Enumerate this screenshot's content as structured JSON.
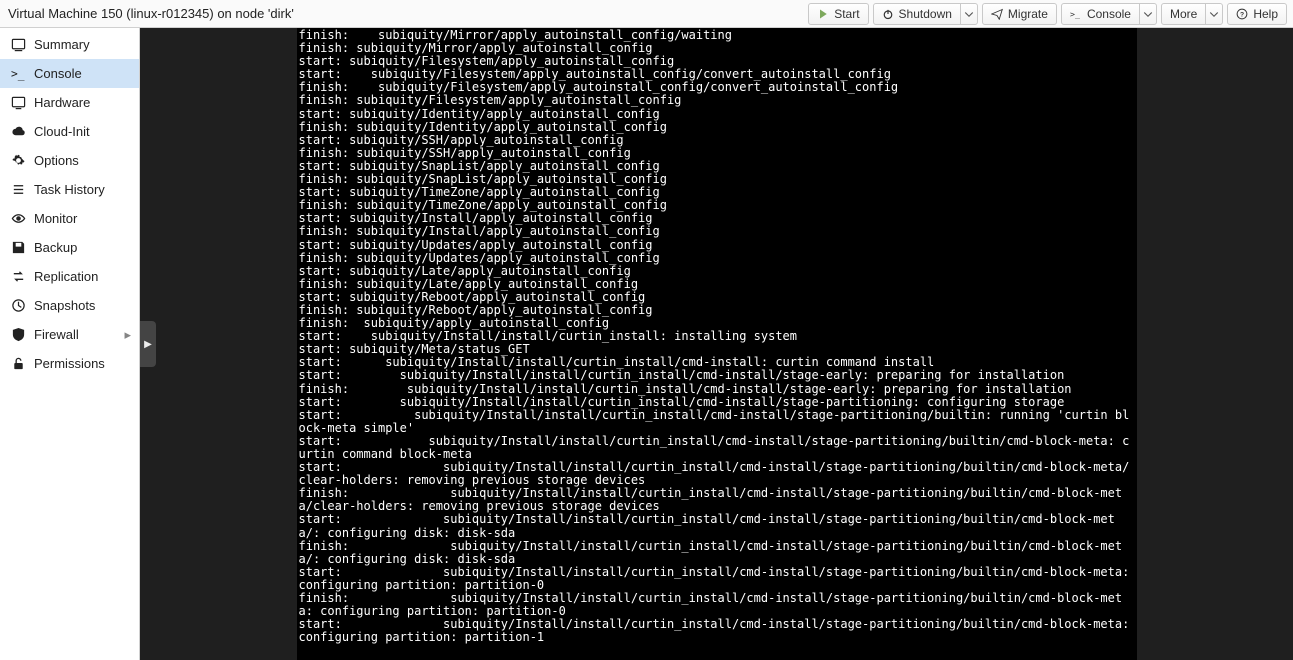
{
  "header": {
    "title": "Virtual Machine 150 (linux-r012345) on node 'dirk'"
  },
  "toolbar": {
    "start": "Start",
    "shutdown": "Shutdown",
    "migrate": "Migrate",
    "console": "Console",
    "more": "More",
    "help": "Help"
  },
  "sidebar": {
    "items": [
      {
        "id": "summary",
        "label": "Summary"
      },
      {
        "id": "console",
        "label": "Console"
      },
      {
        "id": "hardware",
        "label": "Hardware"
      },
      {
        "id": "cloud-init",
        "label": "Cloud-Init"
      },
      {
        "id": "options",
        "label": "Options"
      },
      {
        "id": "task-history",
        "label": "Task History"
      },
      {
        "id": "monitor",
        "label": "Monitor"
      },
      {
        "id": "backup",
        "label": "Backup"
      },
      {
        "id": "replication",
        "label": "Replication"
      },
      {
        "id": "snapshots",
        "label": "Snapshots"
      },
      {
        "id": "firewall",
        "label": "Firewall"
      },
      {
        "id": "permissions",
        "label": "Permissions"
      }
    ],
    "selected": "console"
  },
  "terminal": {
    "lines": "finish:    subiquity/Mirror/apply_autoinstall_config/waiting\nfinish: subiquity/Mirror/apply_autoinstall_config\nstart: subiquity/Filesystem/apply_autoinstall_config\nstart:    subiquity/Filesystem/apply_autoinstall_config/convert_autoinstall_config\nfinish:    subiquity/Filesystem/apply_autoinstall_config/convert_autoinstall_config\nfinish: subiquity/Filesystem/apply_autoinstall_config\nstart: subiquity/Identity/apply_autoinstall_config\nfinish: subiquity/Identity/apply_autoinstall_config\nstart: subiquity/SSH/apply_autoinstall_config\nfinish: subiquity/SSH/apply_autoinstall_config\nstart: subiquity/SnapList/apply_autoinstall_config\nfinish: subiquity/SnapList/apply_autoinstall_config\nstart: subiquity/TimeZone/apply_autoinstall_config\nfinish: subiquity/TimeZone/apply_autoinstall_config\nstart: subiquity/Install/apply_autoinstall_config\nfinish: subiquity/Install/apply_autoinstall_config\nstart: subiquity/Updates/apply_autoinstall_config\nfinish: subiquity/Updates/apply_autoinstall_config\nstart: subiquity/Late/apply_autoinstall_config\nfinish: subiquity/Late/apply_autoinstall_config\nstart: subiquity/Reboot/apply_autoinstall_config\nfinish: subiquity/Reboot/apply_autoinstall_config\nfinish:  subiquity/apply_autoinstall_config\nstart:    subiquity/Install/install/curtin_install: installing system\nstart: subiquity/Meta/status_GET\nstart:      subiquity/Install/install/curtin_install/cmd-install: curtin command install\nstart:        subiquity/Install/install/curtin_install/cmd-install/stage-early: preparing for installation\nfinish:        subiquity/Install/install/curtin_install/cmd-install/stage-early: preparing for installation\nstart:        subiquity/Install/install/curtin_install/cmd-install/stage-partitioning: configuring storage\nstart:          subiquity/Install/install/curtin_install/cmd-install/stage-partitioning/builtin: running 'curtin block-meta simple'\nstart:            subiquity/Install/install/curtin_install/cmd-install/stage-partitioning/builtin/cmd-block-meta: curtin command block-meta\nstart:              subiquity/Install/install/curtin_install/cmd-install/stage-partitioning/builtin/cmd-block-meta/clear-holders: removing previous storage devices\nfinish:              subiquity/Install/install/curtin_install/cmd-install/stage-partitioning/builtin/cmd-block-meta/clear-holders: removing previous storage devices\nstart:              subiquity/Install/install/curtin_install/cmd-install/stage-partitioning/builtin/cmd-block-meta/: configuring disk: disk-sda\nfinish:              subiquity/Install/install/curtin_install/cmd-install/stage-partitioning/builtin/cmd-block-meta/: configuring disk: disk-sda\nstart:              subiquity/Install/install/curtin_install/cmd-install/stage-partitioning/builtin/cmd-block-meta: configuring partition: partition-0\nfinish:              subiquity/Install/install/curtin_install/cmd-install/stage-partitioning/builtin/cmd-block-meta: configuring partition: partition-0\nstart:              subiquity/Install/install/curtin_install/cmd-install/stage-partitioning/builtin/cmd-block-meta: configuring partition: partition-1"
  }
}
